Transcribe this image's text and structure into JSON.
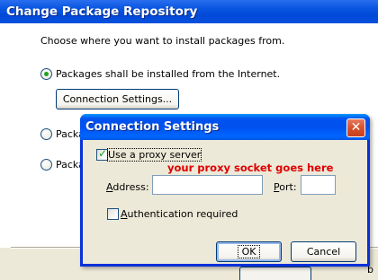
{
  "parent": {
    "title": "Change Package Repository",
    "prompt": "Choose where you want to install packages from.",
    "options": [
      {
        "label": "Packages shall be installed from the Internet.",
        "checked": true
      },
      {
        "label": "Packa",
        "checked": false
      },
      {
        "label": "Packa",
        "checked": false
      }
    ],
    "connection_button": "Connection Settings...",
    "edge_fragment": "b"
  },
  "dialog": {
    "title": "Connection Settings",
    "close_glyph": "✕",
    "use_proxy_label": "Use a proxy server",
    "use_proxy_checked": true,
    "annotation": "your proxy socket goes here",
    "address_label": "Address:",
    "address_value": "",
    "port_label": "Port:",
    "port_value": "",
    "auth_label": "Authentication required",
    "auth_checked": false,
    "ok_label": "OK",
    "cancel_label": "Cancel"
  },
  "colors": {
    "title_blue": "#0053ee",
    "annotation_red": "#e00000",
    "check_green": "#21a121"
  }
}
